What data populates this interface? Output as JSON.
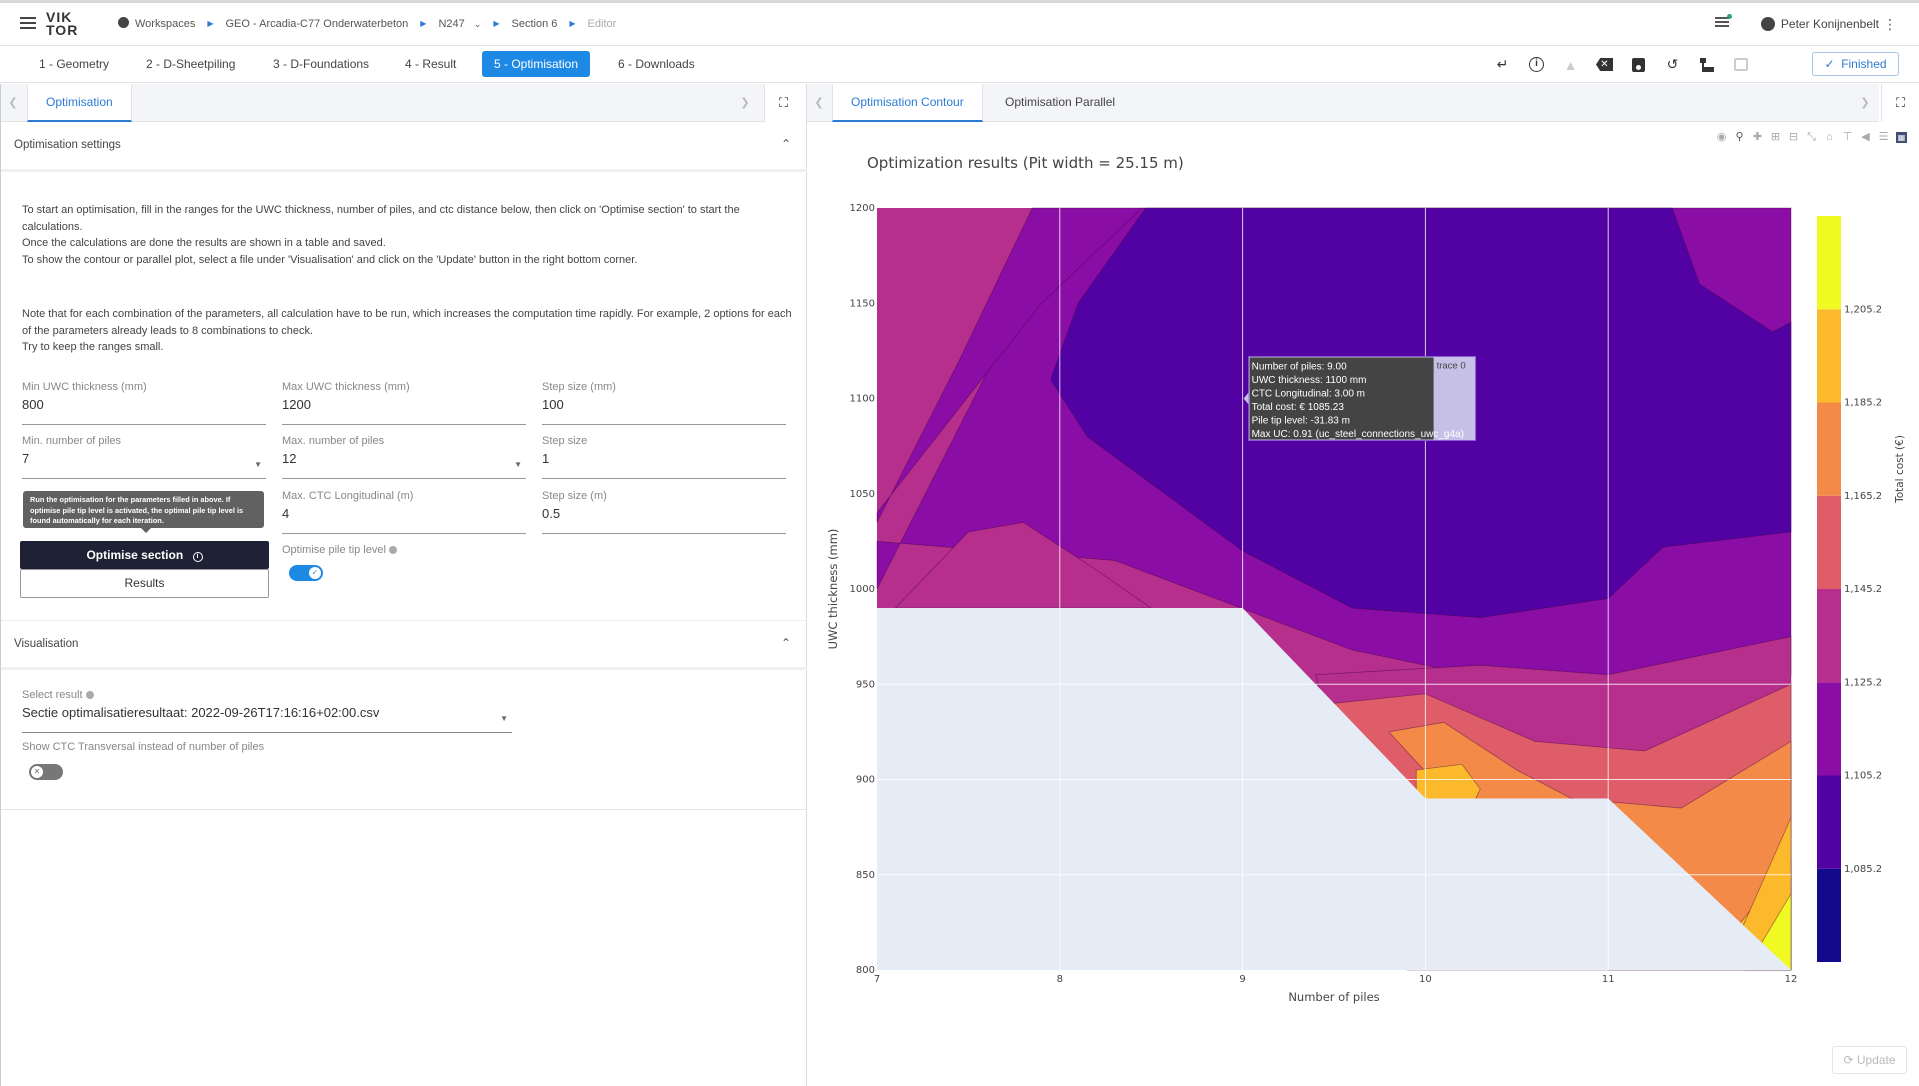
{
  "header": {
    "logo": [
      "VIK",
      "TOR"
    ],
    "breadcrumbs": [
      "Workspaces",
      "GEO - Arcadia-C77 Onderwaterbeton",
      "N247",
      "Section 6",
      "Editor"
    ],
    "user_name": "Peter Konijnenbelt"
  },
  "steps": [
    {
      "label": "1 - Geometry",
      "active": false
    },
    {
      "label": "2 - D-Sheetpiling",
      "active": false
    },
    {
      "label": "3 - D-Foundations",
      "active": false
    },
    {
      "label": "4 - Result",
      "active": false
    },
    {
      "label": "5 - Optimisation",
      "active": true
    },
    {
      "label": "6 - Downloads",
      "active": false
    }
  ],
  "toolbar": {
    "icons": [
      "enter-icon",
      "info-icon",
      "warning-icon",
      "clear-icon",
      "save-icon",
      "history-icon",
      "hierarchy-icon",
      "database-icon"
    ],
    "finished_label": "Finished"
  },
  "left": {
    "tab": "Optimisation",
    "settings_title": "Optimisation settings",
    "intro": [
      "To start an optimisation, fill in the ranges for the UWC thickness, number of piles, and ctc distance below, then click on 'Optimise section' to start the calculations.",
      "Once the calculations are done the results are shown in a table and saved.",
      "To show the contour or parallel plot, select a file under 'Visualisation' and click on the 'Update' button in the right bottom corner."
    ],
    "note": [
      "Note that for each combination of the parameters, all calculation have to be run, which increases the computation time rapidly. For example, 2 options for each of the parameters already leads to 8 combinations to check.",
      "Try to keep the ranges small."
    ],
    "fields": {
      "min_uwc": {
        "label": "Min UWC thickness (mm)",
        "value": "800"
      },
      "max_uwc": {
        "label": "Max UWC thickness (mm)",
        "value": "1200"
      },
      "step_mm": {
        "label": "Step size (mm)",
        "value": "100"
      },
      "min_piles": {
        "label": "Min. number of piles",
        "value": "7"
      },
      "max_piles": {
        "label": "Max. number of piles",
        "value": "12"
      },
      "step_piles": {
        "label": "Step size",
        "value": "1"
      },
      "max_ctc": {
        "label": "Max. CTC Longitudinal (m)",
        "value": "4"
      },
      "step_m": {
        "label": "Step size (m)",
        "value": "0.5"
      }
    },
    "tooltip": "Run the optimisation for the parameters filled in above. If optimise pile tip level is activated, the optimal pile tip level is found automatically for each iteration.",
    "optimise_button": "Optimise section",
    "results_button": "Results",
    "optimise_tip_label": "Optimise pile tip level",
    "optimise_tip_on": true,
    "vis_title": "Visualisation",
    "select_label": "Select result",
    "select_value": "Sectie optimalisatieresultaat: 2022-09-26T17:16:16+02:00.csv",
    "ctc_transversal_label": "Show CTC Transversal instead of number of piles",
    "ctc_transversal_on": false
  },
  "right": {
    "tabs": [
      "Optimisation Contour",
      "Optimisation Parallel"
    ],
    "active_tab": 0,
    "update_label": "Update"
  },
  "chart_data": {
    "type": "contour",
    "title": "Optimization results (Pit width = 25.15 m)",
    "xlabel": "Number of piles",
    "ylabel": "UWC thickness (mm)",
    "colorbar_title": "Total cost (€)",
    "xlim": [
      7,
      12
    ],
    "ylim": [
      800,
      1200
    ],
    "x_ticks": [
      "7",
      "8",
      "9",
      "10",
      "11",
      "12"
    ],
    "y_ticks": [
      "800",
      "850",
      "900",
      "950",
      "1000",
      "1050",
      "1100",
      "1150",
      "1200"
    ],
    "colorbar_ticks": [
      "1,085.2",
      "1,105.2",
      "1,125.2",
      "1,145.2",
      "1,165.2",
      "1,185.2",
      "1,205.2"
    ],
    "contour_levels": [
      1085.2,
      1105.2,
      1125.2,
      1145.2,
      1165.2,
      1185.2,
      1205.2
    ],
    "colorscale": [
      "#0d0887",
      "#4c02a1",
      "#7e03a8",
      "#a92395",
      "#cc4778",
      "#e56b5d",
      "#f89441",
      "#fdc328",
      "#f0f921"
    ],
    "band_colors": [
      "#120a8a",
      "#5202a3",
      "#8a0ea5",
      "#b62f8d",
      "#df5c69",
      "#f48a48",
      "#fdb92c",
      "#f0f921"
    ],
    "no_data_color": "#e5ecf6",
    "hover": {
      "lines": [
        "Number of piles: 9.00",
        "UWC thickness: 1100 mm",
        "CTC Longitudinal: 3.00 m",
        "Total cost: € 1085.23",
        "Pile tip level: -31.83 m",
        "Max UC: 0.91 (uc_steel_connections_uwc_g4a)"
      ],
      "trace": "trace 0",
      "x": 9,
      "y": 1100
    },
    "modebar_icons": [
      "camera-icon",
      "zoom-icon",
      "pan-icon",
      "zoom-in-icon",
      "zoom-out-icon",
      "autoscale-icon",
      "reset-axes-icon",
      "spike-lines-icon",
      "hover-closest-icon",
      "hover-compare-icon",
      "plotly-logo-icon"
    ]
  }
}
